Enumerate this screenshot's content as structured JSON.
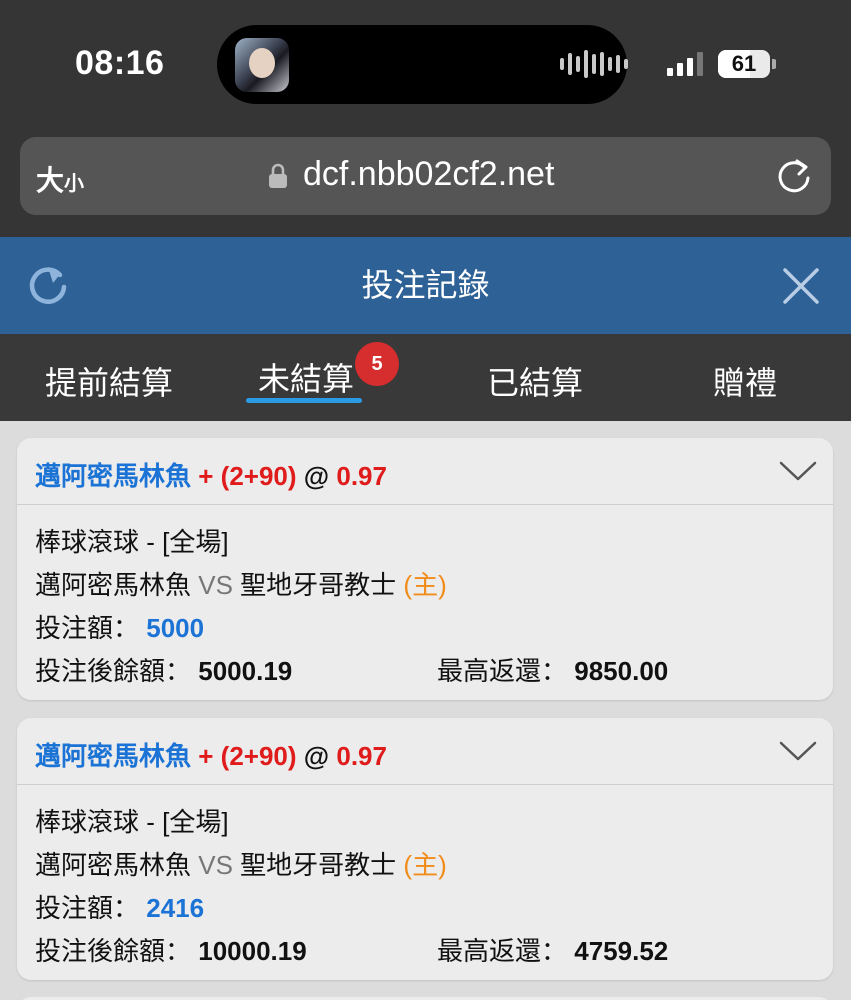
{
  "status_bar": {
    "time": "08:16",
    "battery": "61",
    "battery_level": 0.61,
    "signal_bars": 3
  },
  "browser": {
    "text_size_big": "大",
    "text_size_small": "小",
    "url": "dcf.nbb02cf2.net"
  },
  "header": {
    "title": "投注記錄"
  },
  "tabs": [
    {
      "label": "提前結算"
    },
    {
      "label": "未結算",
      "active": true,
      "badge": "5"
    },
    {
      "label": "已結算"
    },
    {
      "label": "贈禮"
    }
  ],
  "colors": {
    "header": "#2e6196",
    "tab_underline": "#2b9be6",
    "team": "#1c73d6",
    "odds": "#e01b1b",
    "home_tag": "#f08c1a"
  },
  "labels": {
    "vs": "VS",
    "stake": "投注額：",
    "balance_after": "投注後餘額：",
    "max_return": "最高返還："
  },
  "bets": [
    {
      "team": "邁阿密馬林魚",
      "handicap": "+ (2+90)",
      "at": "@",
      "odds": "0.97",
      "market": "棒球滾球 - [全場]",
      "home_team_away": "邁阿密馬林魚",
      "opponent": "聖地牙哥教士",
      "home_tag": "(主)",
      "stake": "5000",
      "balance_after": "5000.19",
      "max_return": "9850.00"
    },
    {
      "team": "邁阿密馬林魚",
      "handicap": "+ (2+90)",
      "at": "@",
      "odds": "0.97",
      "market": "棒球滾球 - [全場]",
      "home_team_away": "邁阿密馬林魚",
      "opponent": "聖地牙哥教士",
      "home_tag": "(主)",
      "stake": "2416",
      "balance_after": "10000.19",
      "max_return": "4759.52"
    }
  ]
}
